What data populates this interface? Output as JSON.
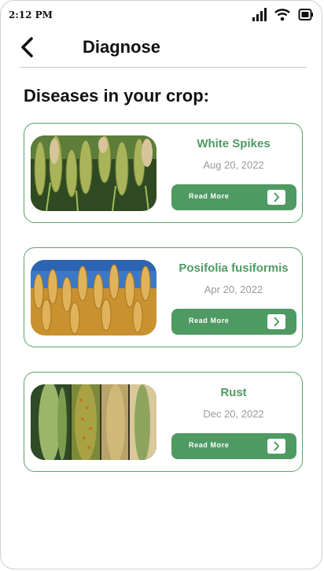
{
  "status_bar": {
    "time": "2:12 PM",
    "icons": [
      "signal-icon",
      "wifi-icon",
      "battery-icon"
    ]
  },
  "header": {
    "title": "Diagnose",
    "back_icon": "chevron-left-icon"
  },
  "section_title": "Diseases in your crop:",
  "colors": {
    "accent": "#4f9a62",
    "card_border": "#5aa36a",
    "date_text": "#9a9a9a"
  },
  "cards": [
    {
      "name": "White Spikes",
      "date": "Aug 20, 2022",
      "button_label": "Read More",
      "image": "green-wheat-spikes-photo"
    },
    {
      "name": "Posifolia fusiformis",
      "date": "Apr 20, 2022",
      "button_label": "Read More",
      "image": "golden-wheat-field-photo"
    },
    {
      "name": "Rust",
      "date": "Dec 20, 2022",
      "button_label": "Read More",
      "image": "rust-infected-leaves-photo"
    }
  ]
}
